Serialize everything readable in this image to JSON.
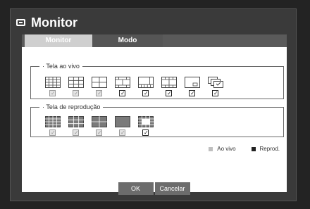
{
  "window": {
    "title": "Monitor"
  },
  "tabs": [
    {
      "label": "Monitor"
    },
    {
      "label": "Modo"
    }
  ],
  "live_group": {
    "title": "Tela ao vivo",
    "layouts": [
      {
        "name": "16-split",
        "checked": false
      },
      {
        "name": "9-split",
        "checked": false
      },
      {
        "name": "4-split",
        "checked": false
      },
      {
        "name": "8-split-a",
        "checked": true
      },
      {
        "name": "8-split-b",
        "checked": true
      },
      {
        "name": "13-split",
        "checked": true
      },
      {
        "name": "pip",
        "checked": true
      },
      {
        "name": "sequence",
        "checked": true
      }
    ]
  },
  "playback_group": {
    "title": "Tela de reprodução",
    "layouts": [
      {
        "name": "16-split",
        "checked": false
      },
      {
        "name": "9-split",
        "checked": false
      },
      {
        "name": "4-split",
        "checked": false
      },
      {
        "name": "single",
        "checked": false
      },
      {
        "name": "multi",
        "checked": true
      }
    ]
  },
  "legend": {
    "live": {
      "label": "Ao vivo",
      "color": "#bfbfbf"
    },
    "playback": {
      "label": "Reprod.",
      "color": "#222222"
    }
  },
  "buttons": {
    "ok": "OK",
    "cancel": "Cancelar"
  },
  "colors": {
    "background": "#232323",
    "frame": "#3a3a3a",
    "panel": "#ffffff",
    "tab_active": "#cfcfcf",
    "tab_inactive": "#555555"
  }
}
